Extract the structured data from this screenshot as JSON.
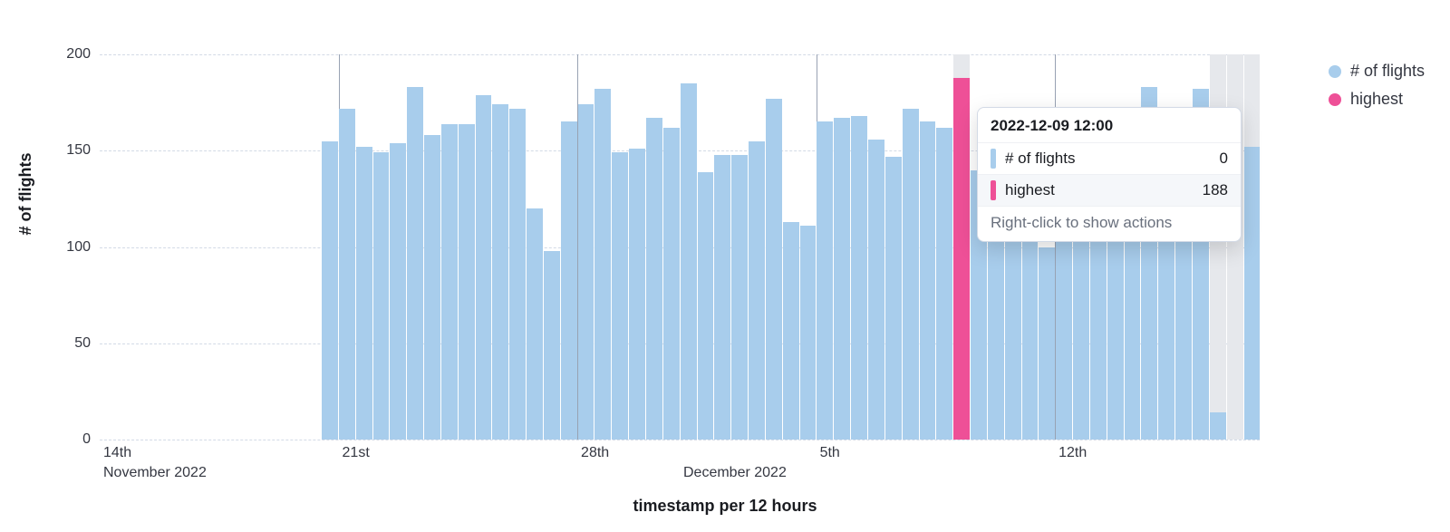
{
  "chart_data": {
    "type": "bar",
    "xlabel": "timestamp per 12 hours",
    "ylabel": "# of flights",
    "ylim": [
      0,
      200
    ],
    "y_ticks": [
      0,
      50,
      100,
      150,
      200
    ],
    "x_ticks": [
      {
        "idx": 0,
        "label": "14th",
        "sub": "November 2022"
      },
      {
        "idx": 14,
        "label": "21st"
      },
      {
        "idx": 28,
        "label": "28th"
      },
      {
        "idx": 34,
        "label": "",
        "sub": "December 2022"
      },
      {
        "idx": 42,
        "label": "5th"
      },
      {
        "idx": 56,
        "label": "12th"
      }
    ],
    "series": [
      {
        "name": "# of flights",
        "color": "#a8cdec",
        "values": [
          0,
          0,
          0,
          0,
          0,
          0,
          0,
          0,
          0,
          0,
          0,
          0,
          0,
          155,
          172,
          152,
          149,
          154,
          183,
          158,
          164,
          164,
          179,
          174,
          172,
          120,
          98,
          165,
          174,
          182,
          149,
          151,
          167,
          162,
          185,
          139,
          148,
          148,
          155,
          177,
          113,
          111,
          165,
          167,
          168,
          156,
          147,
          172,
          165,
          162,
          0,
          140,
          158,
          171,
          152,
          100,
          145,
          143,
          165,
          153,
          155,
          183,
          142,
          168,
          182,
          14,
          0,
          152
        ]
      },
      {
        "name": "highest",
        "color": "#ee5097",
        "values": [
          0,
          0,
          0,
          0,
          0,
          0,
          0,
          0,
          0,
          0,
          0,
          0,
          0,
          0,
          0,
          0,
          0,
          0,
          0,
          0,
          0,
          0,
          0,
          0,
          0,
          0,
          0,
          0,
          0,
          0,
          0,
          0,
          0,
          0,
          0,
          0,
          0,
          0,
          0,
          0,
          0,
          0,
          0,
          0,
          0,
          0,
          0,
          0,
          0,
          0,
          188,
          0,
          0,
          0,
          0,
          0,
          0,
          0,
          0,
          0,
          0,
          0,
          0,
          0,
          0,
          0,
          0,
          0
        ]
      }
    ],
    "greyed_slots": [
      50,
      65,
      66,
      67
    ]
  },
  "legend": {
    "items": [
      {
        "label": "# of flights",
        "color": "#a8cdec"
      },
      {
        "label": "highest",
        "color": "#ee5097"
      }
    ]
  },
  "tooltip": {
    "title": "2022-12-09 12:00",
    "rows": [
      {
        "color": "#a8cdec",
        "label": "# of flights",
        "value": "0",
        "highlight": false
      },
      {
        "color": "#ee5097",
        "label": "highest",
        "value": "188",
        "highlight": true
      }
    ],
    "hint": "Right-click to show actions"
  }
}
